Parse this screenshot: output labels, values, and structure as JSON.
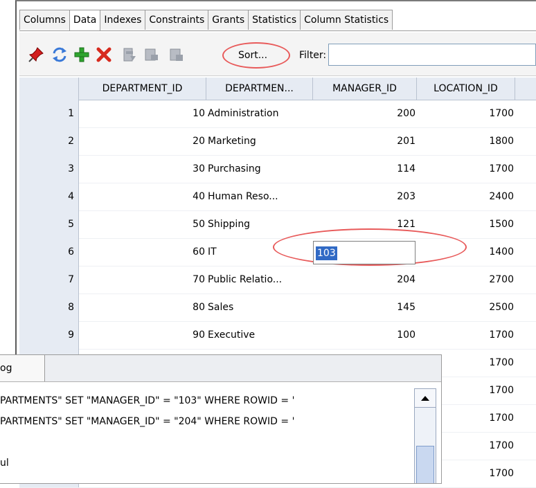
{
  "tabs": [
    "Columns",
    "Data",
    "Indexes",
    "Constraints",
    "Grants",
    "Statistics",
    "Column Statistics"
  ],
  "active_tab": "Data",
  "toolbar": {
    "icons": [
      "pin-icon",
      "refresh-icon",
      "insert-row-icon",
      "delete-row-icon",
      "commit-icon",
      "rollback-icon",
      "rollback-alt-icon"
    ],
    "sort_label": "Sort...",
    "filter_label": "Filter:",
    "filter_value": ""
  },
  "grid": {
    "columns": [
      "DEPARTMENT_ID",
      "DEPARTMEN...",
      "MANAGER_ID",
      "LOCATION_ID"
    ],
    "rows": [
      {
        "n": "1",
        "id": "10",
        "name": "Administration",
        "mgr": "200",
        "loc": "1700"
      },
      {
        "n": "2",
        "id": "20",
        "name": "Marketing",
        "mgr": "201",
        "loc": "1800"
      },
      {
        "n": "3",
        "id": "30",
        "name": "Purchasing",
        "mgr": "114",
        "loc": "1700"
      },
      {
        "n": "4",
        "id": "40",
        "name": "Human Reso...",
        "mgr": "203",
        "loc": "2400"
      },
      {
        "n": "5",
        "id": "50",
        "name": "Shipping",
        "mgr": "121",
        "loc": "1500"
      },
      {
        "n": "6",
        "id": "60",
        "name": "IT",
        "mgr": "",
        "loc": "1400"
      },
      {
        "n": "7",
        "id": "70",
        "name": "Public Relatio...",
        "mgr": "204",
        "loc": "2700"
      },
      {
        "n": "8",
        "id": "80",
        "name": "Sales",
        "mgr": "145",
        "loc": "2500"
      },
      {
        "n": "9",
        "id": "90",
        "name": "Executive",
        "mgr": "100",
        "loc": "1700"
      },
      {
        "n": "",
        "id": "",
        "name": "",
        "mgr": "",
        "loc": "1700"
      },
      {
        "n": "",
        "id": "",
        "name": "",
        "mgr": "",
        "loc": "1700"
      },
      {
        "n": "",
        "id": "",
        "name": "",
        "mgr": "",
        "loc": "1700"
      },
      {
        "n": "",
        "id": "",
        "name": "",
        "mgr": "",
        "loc": "1700"
      },
      {
        "n": "",
        "id": "",
        "name": "",
        "mgr": "",
        "loc": "1700"
      }
    ],
    "editing_value": "103"
  },
  "log": {
    "tab_label": "og",
    "lines": [
      "PARTMENTS\" SET \"MANAGER_ID\" = \"103\" WHERE ROWID = '",
      "PARTMENTS\" SET \"MANAGER_ID\" = \"204\" WHERE ROWID = '",
      "",
      "ul"
    ]
  },
  "colors": {
    "highlight_ellipse": "#e85a5a",
    "selection": "#316ac5",
    "header_bg": "#e6ebf3"
  }
}
